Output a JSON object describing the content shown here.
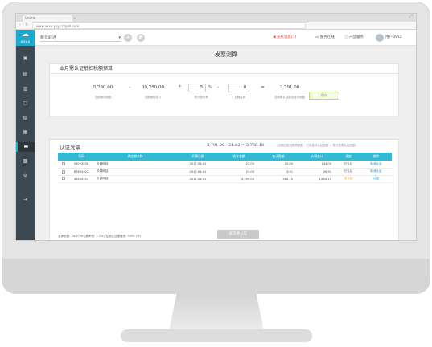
{
  "browser": {
    "tab_title": "Untitle",
    "url": "www.xxxx.yyyy.zzpnh.com"
  },
  "app": {
    "logo_text": "航天信息",
    "company_placeholder": "新云联通",
    "header": {
      "alert": "系统消息(1)",
      "service": "服务在线",
      "help": "产品服务",
      "user": "用户BVYZ"
    }
  },
  "sidebar": {
    "icons": [
      "home-icon",
      "chart-icon",
      "bar-chart-icon",
      "document-icon",
      "clipboard-icon",
      "calendar-icon",
      "invoice-icon",
      "printer-icon",
      "settings-icon",
      "exit-icon"
    ],
    "active_index": 6
  },
  "page": {
    "title": "发票测算",
    "estimate": {
      "heading": "本月需认证抵扣税额预算",
      "sales_tax": "5,780.00",
      "sales_tax_caption": "当期销项税额",
      "income": "39,780.00",
      "income_caption": "当期销售收入",
      "rate": "5",
      "rate_unit": "%",
      "rate_caption": "预计税负率",
      "carry": "0",
      "carry_caption": "上期留抵",
      "result": "3,791.00",
      "result_caption": "当期需认证抵扣进项税额",
      "save_label": "保存"
    },
    "invoices": {
      "heading": "认证发票",
      "formula": "3,791.00  -  24.82  =  3,766.18",
      "hint": "(当期应抵扣进项税额 - 已勾选待认证税额 = 预计还需认证税额)",
      "columns": [
        "号码",
        "供应商名称",
        "开票日期",
        "合计金额",
        "合计税额",
        "价税合计",
        "状态",
        "操作"
      ],
      "rows": [
        {
          "checked": true,
          "number": "54023456",
          "supplier": "长城科技",
          "date": "2017-06-01",
          "amount": "123.00",
          "tax": "20.00",
          "total": "143.00",
          "status": "已认证",
          "status_type": "ok",
          "action": "取消认证"
        },
        {
          "checked": true,
          "number": "87654322",
          "supplier": "长城科技",
          "date": "2017-06-01",
          "amount": "23.00",
          "tax": "3.91",
          "total": "26.91",
          "status": "已认证",
          "status_type": "ok",
          "action": "取消认证"
        },
        {
          "checked": false,
          "number": "45632553",
          "supplier": "长城科技",
          "date": "2017-06-01",
          "amount": "3,295.00",
          "tax": "560.15",
          "total": "3,855.15",
          "status": "未认证",
          "status_type": "wait",
          "action": "认证"
        }
      ],
      "footer": "发票税额: 14.4776  (参考税: 1.1%)  当期应交增值税: 5555 (年)",
      "submit_label": "提交并认证"
    }
  }
}
